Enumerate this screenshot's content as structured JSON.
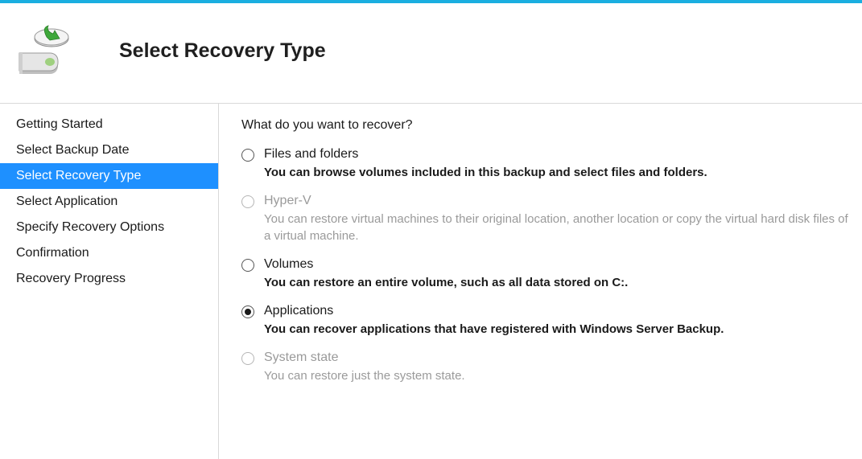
{
  "header": {
    "title": "Select Recovery Type"
  },
  "sidebar": {
    "steps": [
      {
        "label": "Getting Started",
        "active": false
      },
      {
        "label": "Select Backup Date",
        "active": false
      },
      {
        "label": "Select Recovery Type",
        "active": true
      },
      {
        "label": "Select Application",
        "active": false
      },
      {
        "label": "Specify Recovery Options",
        "active": false
      },
      {
        "label": "Confirmation",
        "active": false
      },
      {
        "label": "Recovery Progress",
        "active": false
      }
    ]
  },
  "content": {
    "prompt": "What do you want to recover?",
    "options": [
      {
        "id": "files-folders",
        "title": "Files and folders",
        "desc": "You can browse volumes included in this backup and select files and folders.",
        "selected": false,
        "disabled": false,
        "boldDesc": true
      },
      {
        "id": "hyperv",
        "title": "Hyper-V",
        "desc": "You can restore virtual machines to their original location, another location or copy the virtual hard disk files of a virtual machine.",
        "selected": false,
        "disabled": true,
        "boldDesc": false
      },
      {
        "id": "volumes",
        "title": "Volumes",
        "desc": "You can restore an entire volume, such as all data stored on C:.",
        "selected": false,
        "disabled": false,
        "boldDesc": true
      },
      {
        "id": "applications",
        "title": "Applications",
        "desc": "You can recover applications that have registered with Windows Server Backup.",
        "selected": true,
        "disabled": false,
        "boldDesc": true
      },
      {
        "id": "system-state",
        "title": "System state",
        "desc": "You can restore just the system state.",
        "selected": false,
        "disabled": true,
        "boldDesc": false
      }
    ]
  }
}
